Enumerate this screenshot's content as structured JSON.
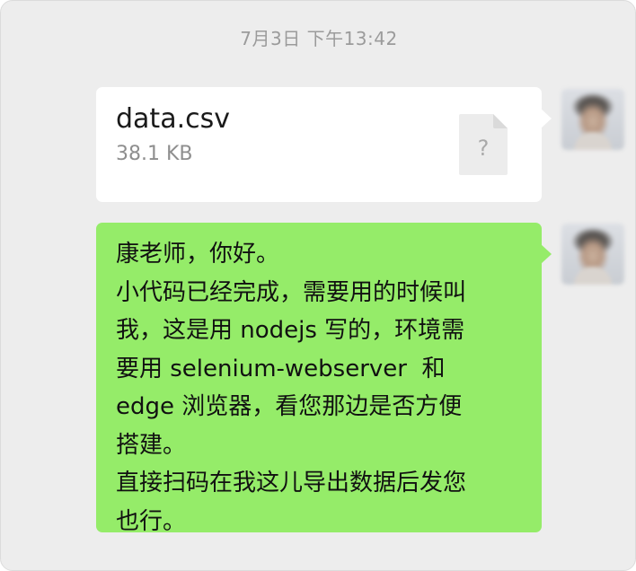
{
  "timestamp": "7月3日 下午13:42",
  "file_message": {
    "file_name": "data.csv",
    "file_size": "38.1 KB",
    "file_icon": "unknown-file-icon",
    "file_icon_glyph": "?"
  },
  "text_message": {
    "lines": [
      "康老师，你好。",
      "小代码已经完成，需要用的时候叫",
      "我，这是用 nodejs 写的，环境需",
      "要用 selenium-webserver  和",
      "edge 浏览器，看您那边是否方便",
      "搭建。",
      "直接扫码在我这儿导出数据后发您",
      "也行。"
    ]
  },
  "colors": {
    "chat_background": "#ededed",
    "sent_bubble": "#95ec69",
    "file_bubble": "#ffffff",
    "timestamp_text": "#9b9b9b",
    "secondary_text": "#8e8e8e"
  }
}
